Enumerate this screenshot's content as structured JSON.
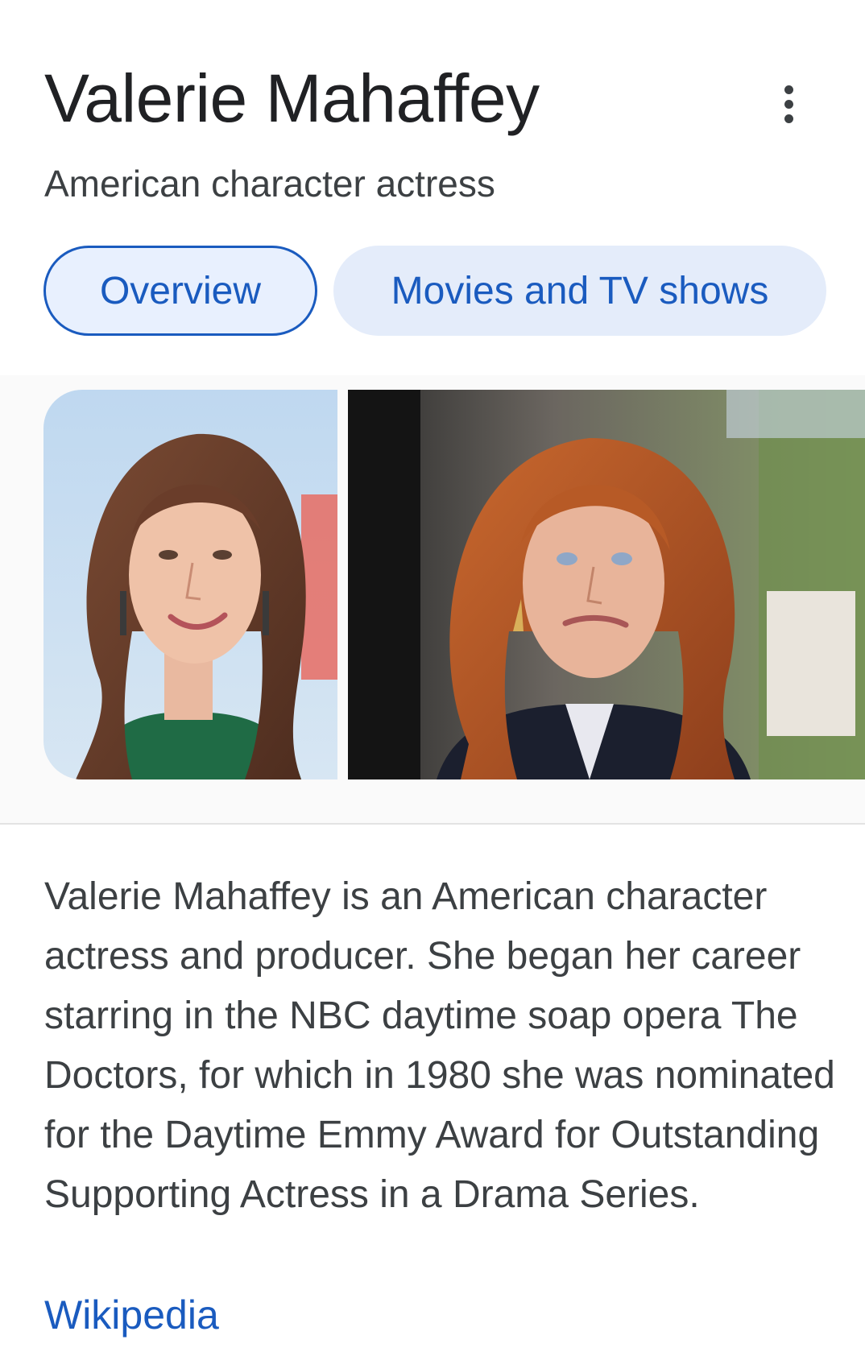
{
  "entity": {
    "name": "Valerie Mahaffey",
    "subtitle": "American character actress"
  },
  "menu": {
    "icon": "more-vert-icon"
  },
  "tabs": [
    {
      "label": "Overview",
      "selected": true
    },
    {
      "label": "Movies and TV shows",
      "selected": false
    }
  ],
  "images": [
    {
      "subject": "portrait-photo"
    },
    {
      "subject": "scene-photo"
    }
  ],
  "description": {
    "text": "Valerie Mahaffey is an American character actress and producer. She began her career starring in the NBC daytime soap opera The Doctors, for which in 1980 she was nominated for the Daytime Emmy Award for Outstanding Supporting Actress in a Drama Series.",
    "source_label": "Wikipedia"
  },
  "colors": {
    "link": "#1a5bbf",
    "chip_selected_border": "#1a5bbf",
    "chip_background": "#e4ecfa",
    "title_text": "#202124",
    "body_text": "#3c4043"
  }
}
